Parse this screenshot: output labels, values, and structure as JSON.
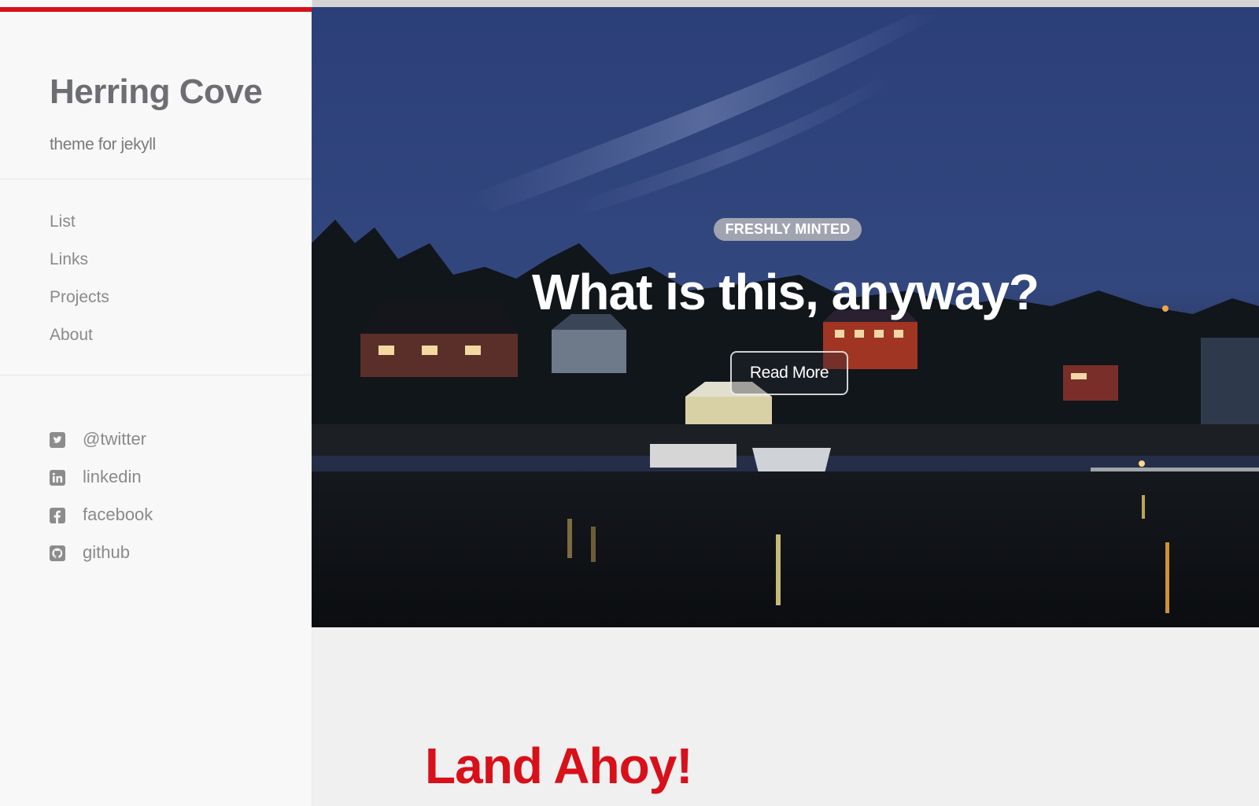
{
  "site": {
    "title": "Herring Cove",
    "tagline": "theme for jekyll"
  },
  "nav": [
    {
      "label": "List"
    },
    {
      "label": "Links"
    },
    {
      "label": "Projects"
    },
    {
      "label": "About"
    }
  ],
  "social": [
    {
      "icon": "twitter-icon",
      "label": "@twitter"
    },
    {
      "icon": "linkedin-icon",
      "label": "linkedin"
    },
    {
      "icon": "facebook-icon",
      "label": "facebook"
    },
    {
      "icon": "github-icon",
      "label": "github"
    }
  ],
  "hero": {
    "badge": "FRESHLY MINTED",
    "title": "What is this, anyway?",
    "button": "Read More"
  },
  "post": {
    "title": "Land Ahoy!"
  },
  "colors": {
    "accent": "#d8101a",
    "sidebar_bg": "#f8f8f8",
    "text_muted": "#8a8a8a"
  }
}
